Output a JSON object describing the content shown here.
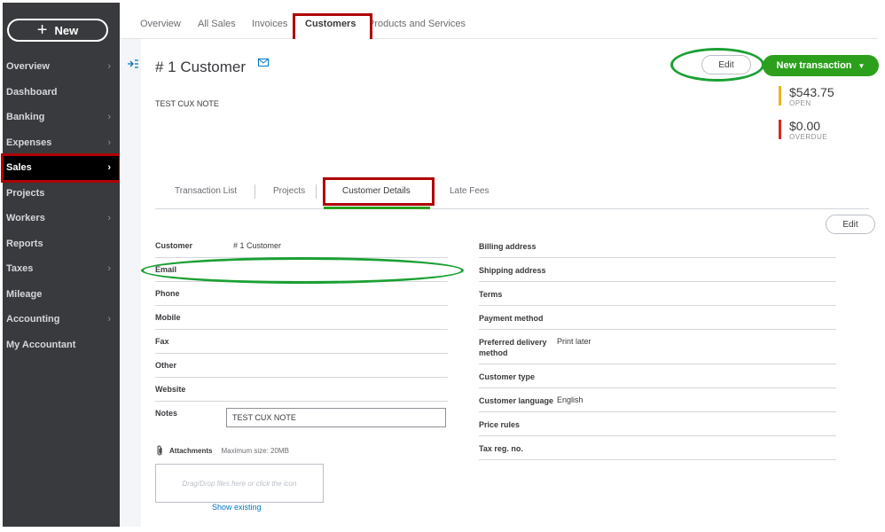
{
  "sidebar": {
    "new_label": "New",
    "items": [
      {
        "label": "Overview",
        "chevron": true
      },
      {
        "label": "Dashboard",
        "chevron": false
      },
      {
        "label": "Banking",
        "chevron": true
      },
      {
        "label": "Expenses",
        "chevron": true
      },
      {
        "label": "Sales",
        "chevron": true,
        "active": true
      },
      {
        "label": "Projects",
        "chevron": false
      },
      {
        "label": "Workers",
        "chevron": true
      },
      {
        "label": "Reports",
        "chevron": false
      },
      {
        "label": "Taxes",
        "chevron": true
      },
      {
        "label": "Mileage",
        "chevron": false
      },
      {
        "label": "Accounting",
        "chevron": true
      },
      {
        "label": "My Accountant",
        "chevron": false
      }
    ]
  },
  "top_tabs": [
    "Overview",
    "All Sales",
    "Invoices",
    "Customers",
    "Products and Services"
  ],
  "active_top_tab": "Customers",
  "customer": {
    "title": "# 1 Customer",
    "note": "TEST CUX NOTE",
    "edit_label": "Edit",
    "new_transaction_label": "New transaction",
    "open_amount": "$543.75",
    "open_label": "OPEN",
    "overdue_amount": "$0.00",
    "overdue_label": "OVERDUE"
  },
  "sub_tabs": [
    "Transaction List",
    "Projects",
    "Customer Details",
    "Late Fees"
  ],
  "active_sub_tab": "Customer Details",
  "details": {
    "edit_label": "Edit",
    "left": [
      {
        "label": "Customer",
        "value": "# 1 Customer"
      },
      {
        "label": "Email",
        "value": ""
      },
      {
        "label": "Phone",
        "value": ""
      },
      {
        "label": "Mobile",
        "value": ""
      },
      {
        "label": "Fax",
        "value": ""
      },
      {
        "label": "Other",
        "value": ""
      },
      {
        "label": "Website",
        "value": ""
      }
    ],
    "notes_label": "Notes",
    "notes_value": "TEST CUX NOTE",
    "right": [
      {
        "label": "Billing address",
        "value": ""
      },
      {
        "label": "Shipping address",
        "value": ""
      },
      {
        "label": "Terms",
        "value": ""
      },
      {
        "label": "Payment method",
        "value": ""
      },
      {
        "label": "Preferred delivery method",
        "value": "Print later"
      },
      {
        "label": "Customer type",
        "value": ""
      },
      {
        "label": "Customer language",
        "value": "English"
      },
      {
        "label": "Price rules",
        "value": ""
      },
      {
        "label": "Tax reg. no.",
        "value": ""
      }
    ],
    "attachments_label": "Attachments",
    "attachments_max": "Maximum size: 20MB",
    "dropzone_text": "Drag/Drop files here or click the icon",
    "show_existing": "Show existing"
  },
  "colors": {
    "sidebar_bg": "#393a3d",
    "brand_green": "#2ca01c",
    "open_bar": "#f2b01e",
    "overdue_bar": "#d52b1e",
    "link_blue": "#0077c5",
    "highlight_red": "#b00000",
    "annotation_green": "#1aa033"
  },
  "icons": {
    "new_button": "plus-icon",
    "collapse": "collapse-panel-icon",
    "email": "mail-icon",
    "attachments": "paperclip-icon"
  }
}
